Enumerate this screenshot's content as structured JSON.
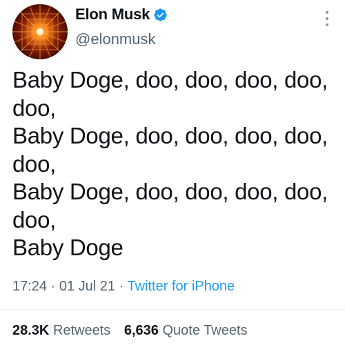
{
  "author": {
    "name": "Elon Musk",
    "handle": "@elonmusk",
    "verified": true,
    "avatar_icon": "radial-burst-avatar"
  },
  "tweet": {
    "text": "Baby Doge, doo, doo, doo, doo,\ndoo,\nBaby Doge, doo, doo, doo, doo,\ndoo,\nBaby Doge, doo, doo, doo, doo,\ndoo,\nBaby Doge",
    "time": "17:24",
    "date": "01 Jul 21",
    "separator": "·",
    "source": "Twitter for iPhone"
  },
  "stats": {
    "retweets_count": "28.3K",
    "retweets_label": "Retweets",
    "quotes_count": "6,636",
    "quotes_label": "Quote Tweets"
  },
  "colors": {
    "link": "#1d9bf0",
    "secondary_text": "#536471",
    "primary_text": "#0f1419",
    "verified_badge": "#1d9bf0"
  }
}
